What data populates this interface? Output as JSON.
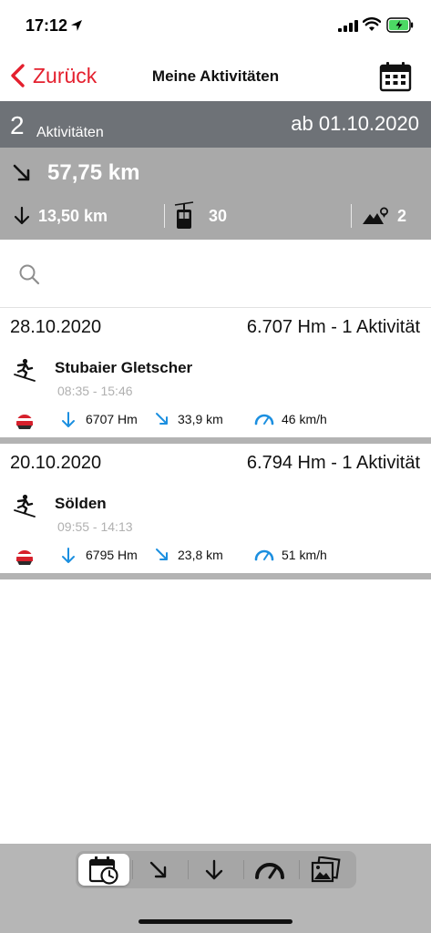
{
  "status_bar": {
    "time": "17:12"
  },
  "nav": {
    "back_label": "Zurück",
    "title": "Meine Aktivitäten"
  },
  "summary": {
    "count": "2",
    "count_label": "Aktivitäten",
    "since": "ab 01.10.2020",
    "distance": "57,75 km",
    "descent": "13,50 km",
    "lifts": "30",
    "peaks": "2"
  },
  "search": {
    "placeholder": ""
  },
  "groups": [
    {
      "date": "28.10.2020",
      "summary": "6.707 Hm - 1 Aktivität",
      "activity": {
        "name": "Stubaier Gletscher",
        "time": "08:35 - 15:46",
        "descent": "6707 Hm",
        "distance": "33,9 km",
        "speed": "46 km/h"
      }
    },
    {
      "date": "20.10.2020",
      "summary": "6.794 Hm - 1 Aktivität",
      "activity": {
        "name": "Sölden",
        "time": "09:55 - 14:13",
        "descent": "6795 Hm",
        "distance": "23,8 km",
        "speed": "51 km/h"
      }
    }
  ],
  "tab_bar": {
    "items": [
      "calendar-clock-icon",
      "distance-arrow-icon",
      "descent-arrow-icon",
      "speedometer-icon",
      "photos-icon"
    ],
    "active": "calendar-clock-icon"
  },
  "colors": {
    "accent": "#e4202e",
    "stat_blue": "#1b8fe0",
    "header_dark": "#6e7277",
    "header_light": "#a9a9a9"
  }
}
